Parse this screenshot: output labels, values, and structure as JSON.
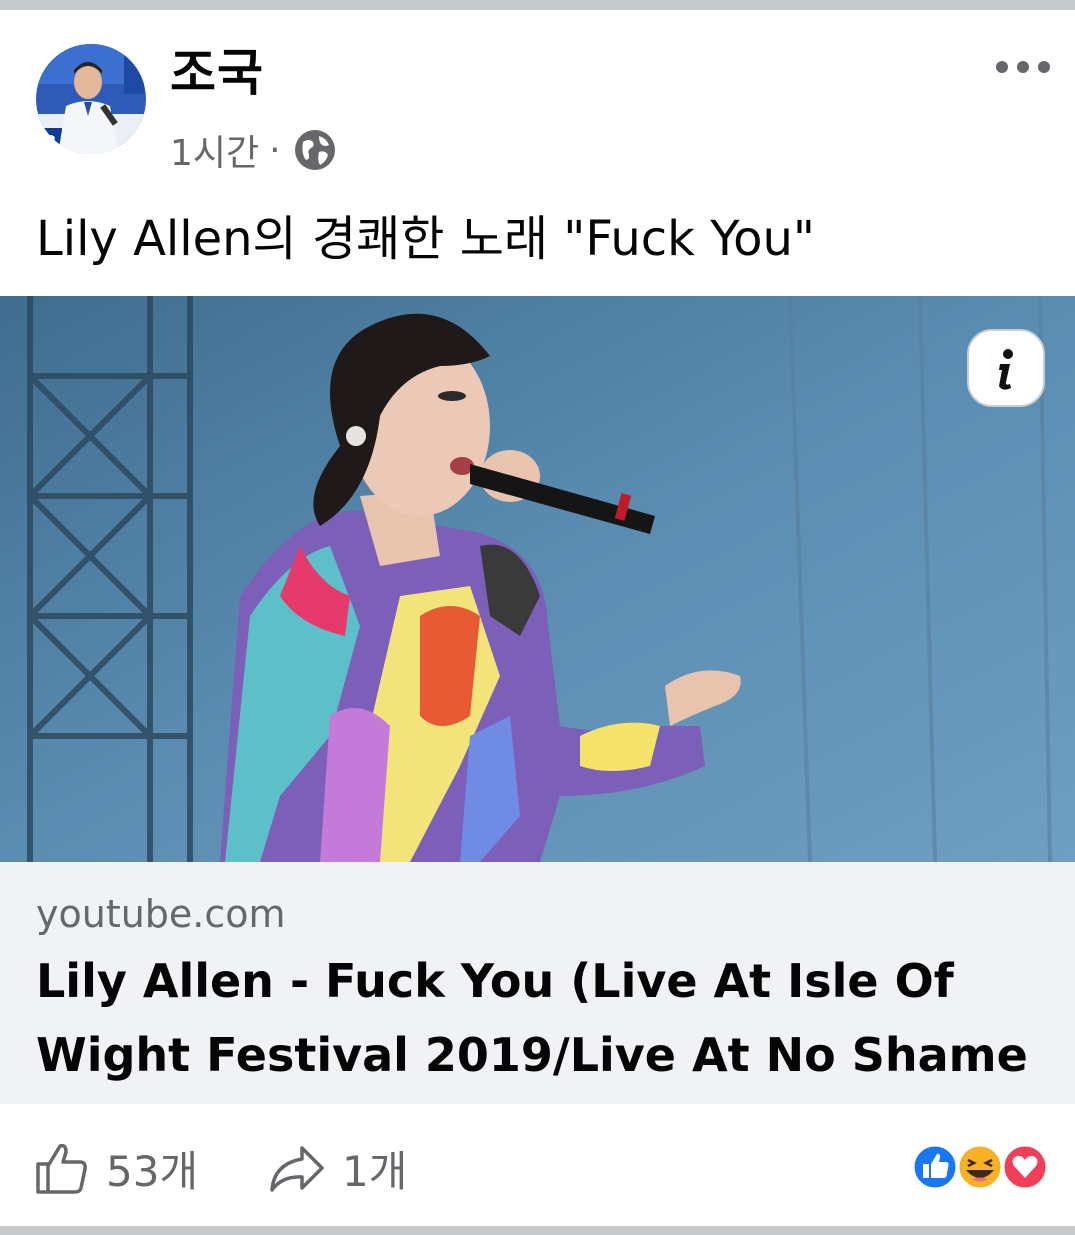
{
  "post": {
    "author": "조국",
    "time": "1시간",
    "separator": "·",
    "visibility_icon": "globe-icon",
    "text": "Lily Allen의 경쾌한 노래 \"Fuck You\""
  },
  "link_preview": {
    "domain": "youtube.com",
    "title_line1": "Lily Allen - Fuck You (Live At Isle Of",
    "title_line2": "Wight Festival 2019/Live At No Shame ..."
  },
  "actions": {
    "like_count": "53개",
    "share_count": "1개",
    "reactions": [
      "like-reaction-icon",
      "haha-reaction-icon",
      "love-reaction-icon"
    ]
  },
  "colors": {
    "secondary_text": "#65676b",
    "like_blue": "#1877f2",
    "love_red": "#f33e58",
    "haha_yellow": "#f7b125",
    "link_card_bg": "#f0f2f5"
  }
}
